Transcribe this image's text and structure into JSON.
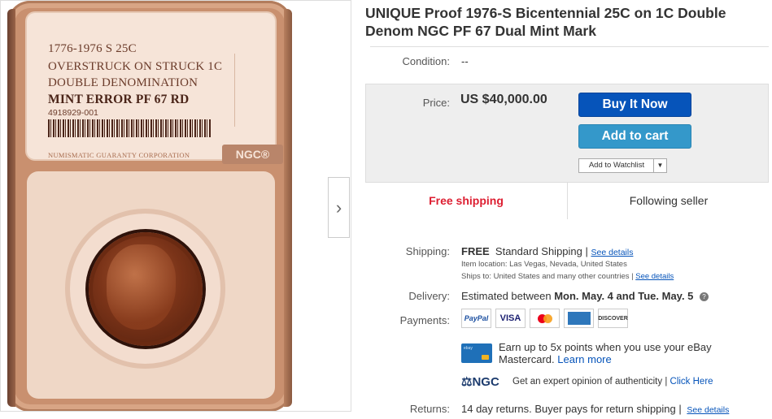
{
  "photo": {
    "label_lines": [
      "1776-1976 S 25C",
      "OVERSTRUCK ON STRUCK 1C",
      "DOUBLE DENOMINATION",
      "MINT ERROR PF 67 RD"
    ],
    "serial": "4918929-001",
    "corp": "NUMISMATIC GUARANTY CORPORATION",
    "logo": "NGC®",
    "next_icon": "chevron-right-icon"
  },
  "listing": {
    "title": "UNIQUE Proof 1976-S Bicentennial 25C on 1C Double Denom NGC PF 67 Dual Mint Mark",
    "condition_label": "Condition:",
    "condition_value": "--",
    "price_label": "Price:",
    "price_value": "US $40,000.00",
    "buy_now": "Buy It Now",
    "add_to_cart": "Add to cart",
    "watchlist": "Add to Watchlist",
    "free_shipping": "Free shipping",
    "following_seller": "Following seller"
  },
  "shipping": {
    "label": "Shipping:",
    "free": "FREE",
    "method": "Standard Shipping |",
    "see_details": "See details",
    "item_location": "Item location:  Las Vegas, Nevada, United States",
    "ships_to": "Ships to:  United States and many other countries |",
    "ships_to_link": "See details"
  },
  "delivery": {
    "label": "Delivery:",
    "prefix": "Estimated between",
    "range": "Mon. May. 4 and Tue. May. 5",
    "help_icon": "question-circle-icon"
  },
  "payments": {
    "label": "Payments:",
    "methods": [
      "PayPal",
      "VISA",
      "Mastercard",
      "AMEX",
      "DISCOVER"
    ],
    "card_offer_line1": "Earn up to 5x points when you use your eBay",
    "card_offer_line2": "Mastercard.",
    "learn_more": "Learn more",
    "card_icon_text": "ebay",
    "ngc_logo": "NGC",
    "ngc_text": "Get an expert opinion of authenticity |",
    "click_here": "Click Here"
  },
  "returns": {
    "label": "Returns:",
    "text": "14 day returns. Buyer pays for return shipping |",
    "see_details": "See details"
  },
  "colors": {
    "buy_now": "#0654ba",
    "add_to_cart": "#3498ca",
    "free_shipping": "#dd1e31",
    "link": "#0654ba"
  }
}
